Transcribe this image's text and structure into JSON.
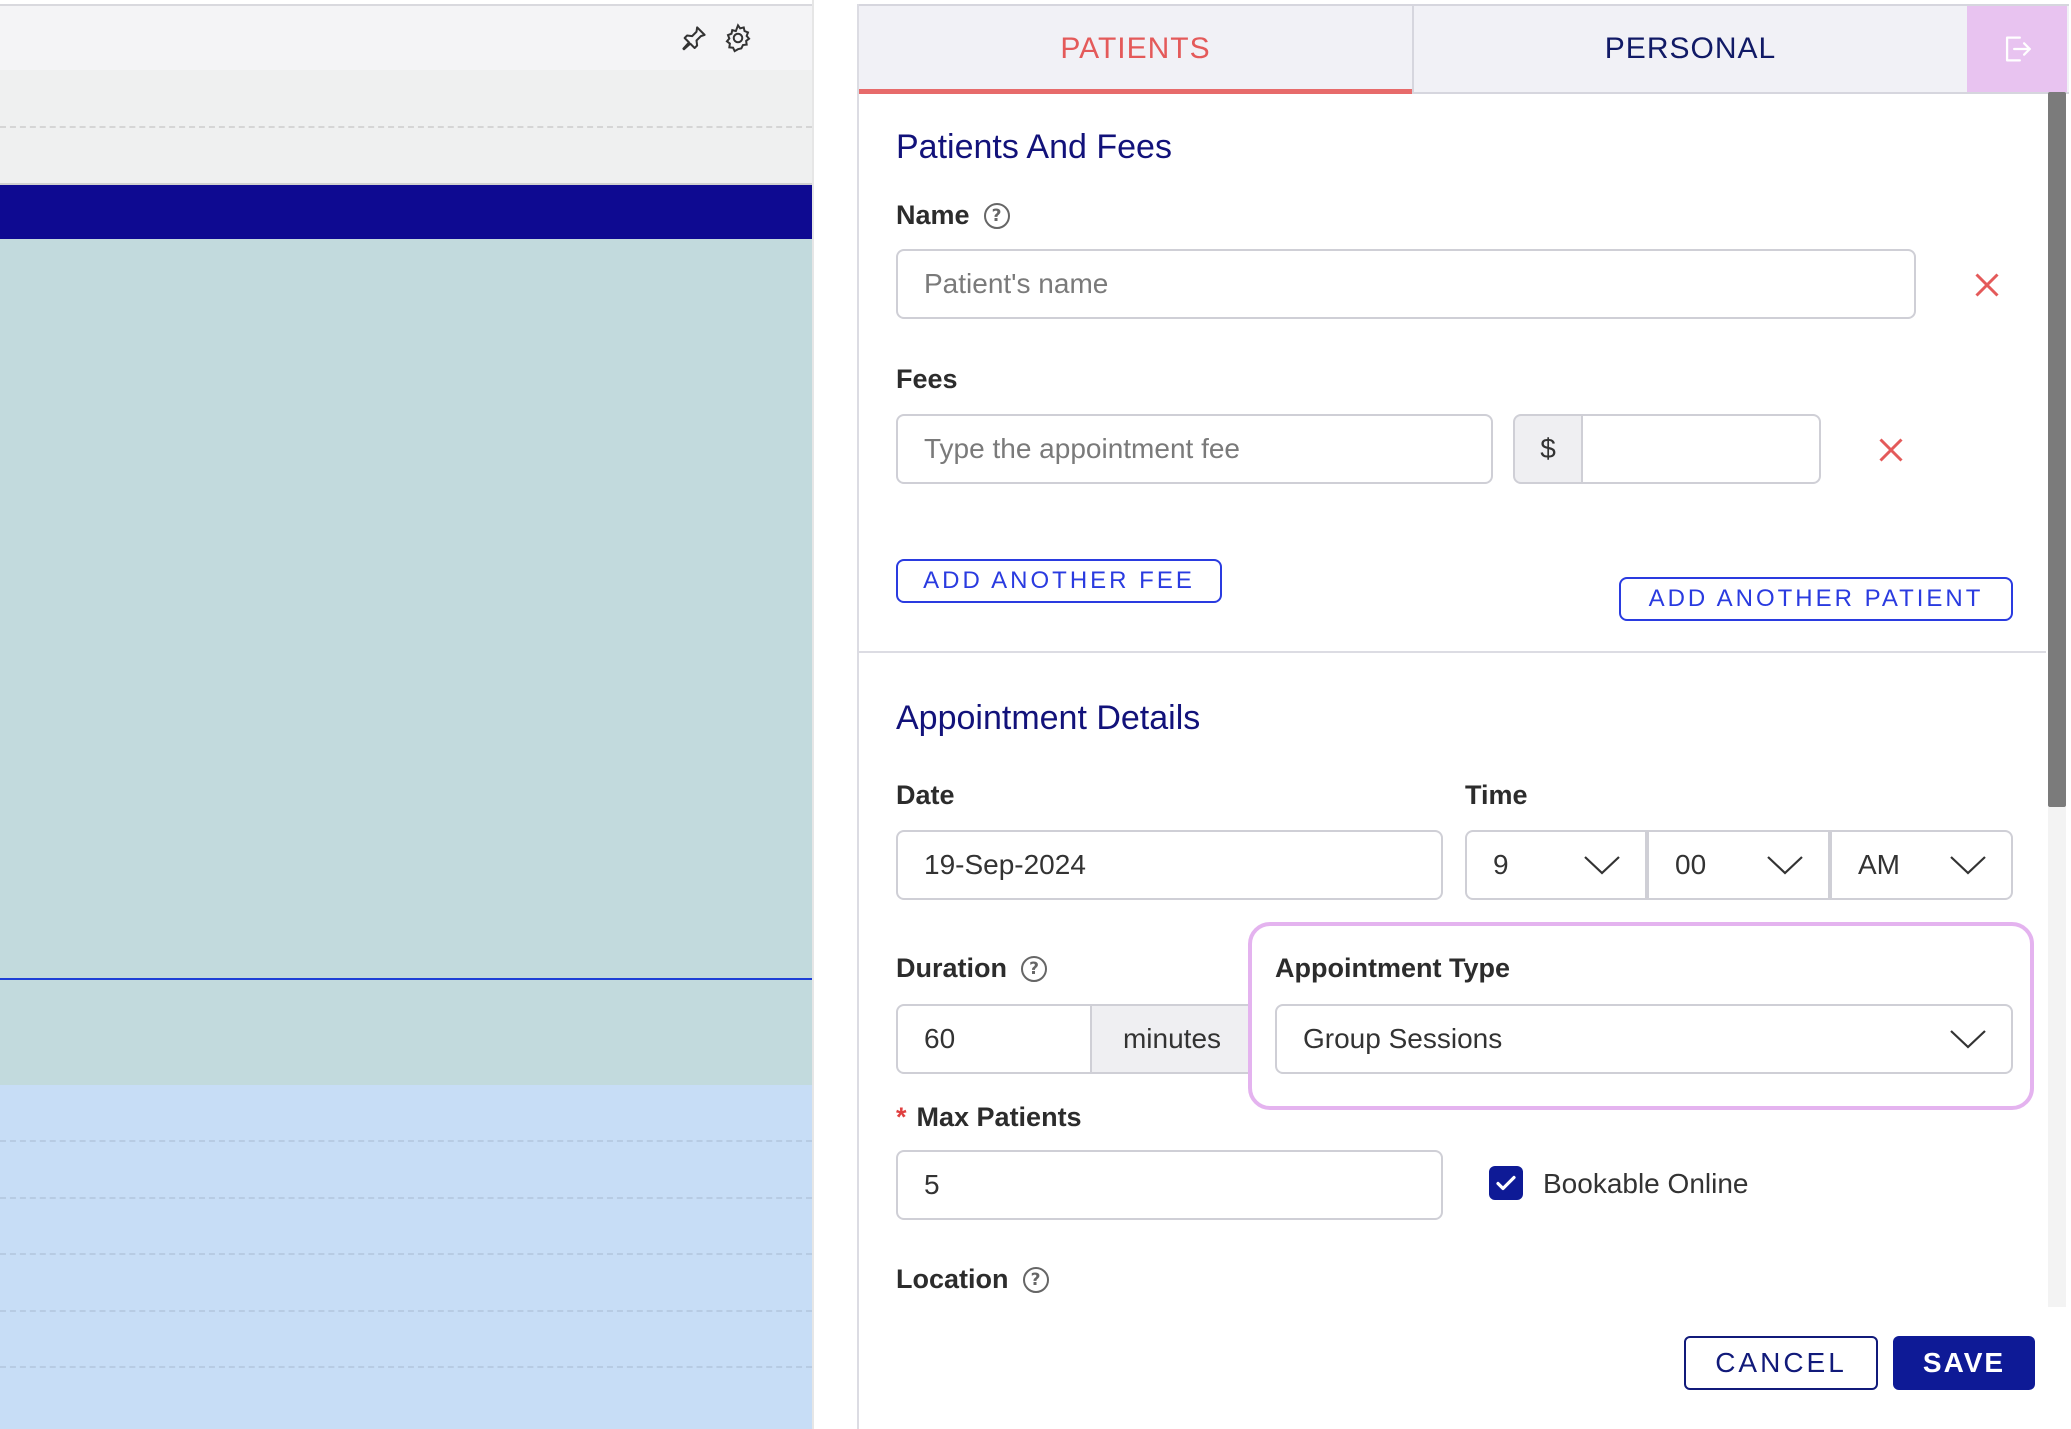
{
  "tabs": {
    "patients": "PATIENTS",
    "personal": "PERSONAL"
  },
  "icons": {
    "pin": "pin-icon",
    "settings": "gear-icon",
    "exit": "logout-icon",
    "help": "help-circle-icon",
    "remove": "close-icon",
    "dropdown": "chevron-down-icon",
    "check": "checkmark-icon"
  },
  "patients_section": {
    "title": "Patients And Fees",
    "name_label": "Name",
    "help_glyph": "?",
    "name_placeholder": "Patient's name",
    "fees_label": "Fees",
    "fee_placeholder": "Type the appointment fee",
    "currency_symbol": "$",
    "fee_amount": "",
    "add_fee_button": "ADD ANOTHER FEE",
    "add_patient_button": "ADD ANOTHER PATIENT"
  },
  "appointment": {
    "title": "Appointment Details",
    "date_label": "Date",
    "date_value": "19-Sep-2024",
    "time_label": "Time",
    "hour": "9",
    "minute": "00",
    "ampm": "AM",
    "duration_label": "Duration",
    "duration_value": "60",
    "duration_unit": "minutes",
    "type_label": "Appointment Type",
    "type_value": "Group Sessions",
    "max_patients_required": "*",
    "max_patients_label": "Max Patients",
    "max_patients_value": "5",
    "bookable_online_label": "Bookable Online",
    "bookable_online_checked": true,
    "location_label": "Location"
  },
  "footer": {
    "cancel": "CANCEL",
    "save": "SAVE"
  },
  "colors": {
    "accent_navy": "#0e1a96",
    "tab_active": "#e45a5a",
    "link_blue": "#2a3be0",
    "highlight": "#e4b3ef",
    "calendar_band": "#0e0a91",
    "calendar_teal": "#c2dadd",
    "calendar_lightblue": "#c7ddf6"
  }
}
